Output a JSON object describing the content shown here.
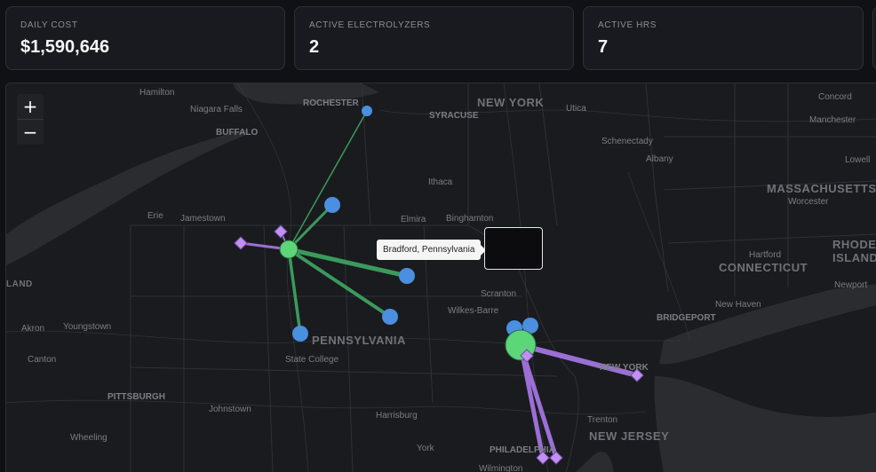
{
  "stats": [
    {
      "label": "DAILY COST",
      "value": "$1,590,646"
    },
    {
      "label": "ACTIVE ELECTROLYZERS",
      "value": "2"
    },
    {
      "label": "ACTIVE HRS",
      "value": "7"
    }
  ],
  "map": {
    "zoom_in": "+",
    "zoom_out": "−",
    "tooltip": "Bradford, Pennsylvania",
    "region_labels": {
      "new_york": "NEW YORK",
      "pennsylvania": "PENNSYLVANIA",
      "massachusetts": "MASSACHUSETTS",
      "connecticut": "CONNECTICUT",
      "rhode": "RHODE",
      "island": "ISLAND",
      "new_jersey": "NEW JERSEY",
      "land": "LAND"
    },
    "city_labels": {
      "hamilton": "Hamilton",
      "niagara_falls": "Niagara Falls",
      "rochester": "ROCHESTER",
      "buffalo": "BUFFALO",
      "syracuse": "SYRACUSE",
      "utica": "Utica",
      "concord": "Concord",
      "manchester": "Manchester",
      "lowell": "Lowell",
      "schenectady": "Schenectady",
      "albany": "Albany",
      "ithaca": "Ithaca",
      "worcester": "Worcester",
      "erie": "Erie",
      "jamestown": "Jamestown",
      "elmira": "Elmira",
      "binghamton": "Binghamton",
      "hartford": "Hartford",
      "newport": "Newport",
      "scranton": "Scranton",
      "new_haven": "New Haven",
      "wilkes_barre": "Wilkes-Barre",
      "bridgeport": "BRIDGEPORT",
      "akron": "Akron",
      "youngstown": "Youngstown",
      "canton": "Canton",
      "state_college": "State College",
      "pittsburgh": "PITTSBURGH",
      "johnstown": "Johnstown",
      "harrisburg": "Harrisburg",
      "trenton": "Trenton",
      "wheeling": "Wheeling",
      "york": "York",
      "philadelphia": "PHILADELPHIA",
      "new_york_city": "NEW YORK",
      "wilmington": "Wilmington"
    }
  },
  "colors": {
    "green_flow": "#3a9a5c",
    "green_hub": "#5dd67a",
    "purple_flow": "#9b6fd6",
    "purple_marker": "#c190f2",
    "blue_node": "#4a8fe0",
    "land": "#1a1b1e",
    "water": "#2a2c30"
  }
}
